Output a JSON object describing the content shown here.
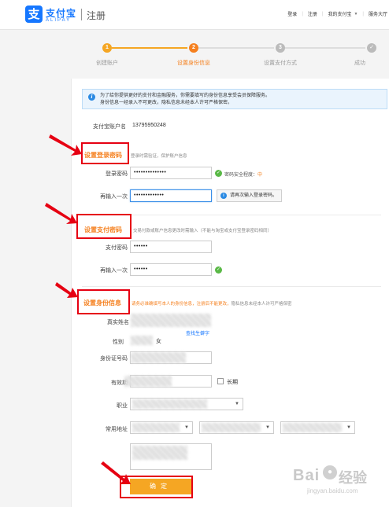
{
  "header": {
    "brand_cn": "支付宝",
    "brand_en": "ALIPAY",
    "page_title": "注册",
    "nav": [
      "登录",
      "注册",
      "我的支付宝",
      "服务大厅"
    ]
  },
  "steps": [
    {
      "num": "1",
      "label": "创建账户",
      "state": "done"
    },
    {
      "num": "2",
      "label": "设置身份信息",
      "state": "active"
    },
    {
      "num": "3",
      "label": "设置支付方式",
      "state": "todo"
    },
    {
      "num": "✓",
      "label": "成功",
      "state": "todo"
    }
  ],
  "notice": {
    "line1": "为了给你提供更好的支付和金融服务，你需要填写的身份信息享受会员保障服务。",
    "line2": "身份信息一经录入不可更改，隐私信息未经本人许可严格保密。"
  },
  "account": {
    "label": "支付宝账户名",
    "value": "13795950248"
  },
  "login_pw": {
    "title": "设置登录密码",
    "desc": "登录时需验证，保护账户信息",
    "label1": "登录密码",
    "value1": "••••••••••••••",
    "strength_label": "密码安全程度：",
    "strength_value": "中",
    "label2": "再输入一次",
    "value2": "•••••••••••••",
    "tip": "请再次输入登录密码。"
  },
  "pay_pw": {
    "title": "设置支付密码",
    "desc": "交易付款或账户信息更改时需输入（不能与淘宝或支付宝登录密码相同）",
    "label1": "支付密码",
    "value1": "••••••",
    "label2": "再输入一次",
    "value2": "••••••"
  },
  "identity": {
    "title": "设置身份信息",
    "desc_a": "请务必准确填写本人的身份信息，",
    "desc_b": "注册后不能更改，",
    "desc_c": "隐私信息未经本人许可严格保密",
    "name_label": "真实姓名",
    "rare_char_link": "查找生僻字",
    "gender_label": "性别",
    "gender_female": "女",
    "id_label": "身份证号码",
    "expiry_label": "有效期",
    "long_term": "长期",
    "job_label": "职业",
    "address_label": "常用地址"
  },
  "submit_label": "确定",
  "watermark": {
    "text_a": "Bai",
    "text_b": "经验",
    "url": "jingyan.baidu.com"
  },
  "colors": {
    "brand": "#1677ff",
    "accent": "#f5801f",
    "annotation": "#e60012",
    "success": "#5ab947"
  }
}
